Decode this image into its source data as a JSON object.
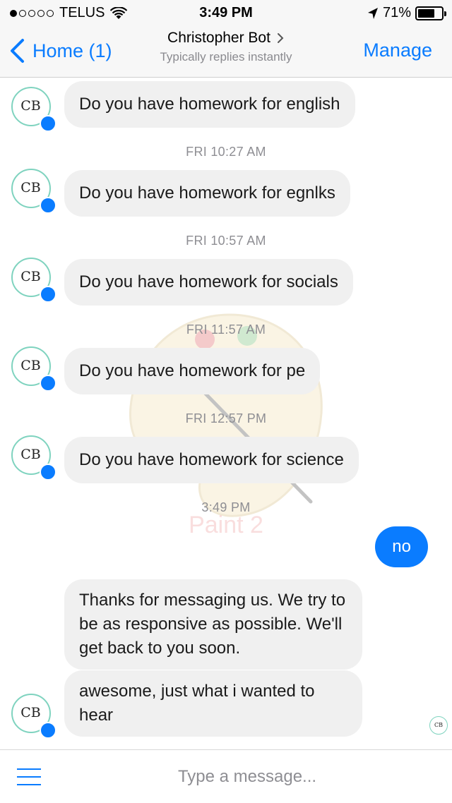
{
  "status_bar": {
    "carrier": "TELUS",
    "signal_dots_filled": 1,
    "signal_dots_total": 5,
    "time": "3:49 PM",
    "battery_text": "71%",
    "battery_level": 0.71
  },
  "nav": {
    "back_label": "Home (1)",
    "title": "Christopher Bot",
    "subtitle": "Typically replies instantly",
    "manage_label": "Manage"
  },
  "avatar": {
    "initials": "CB",
    "ring_color": "#7fd3bf",
    "badge_color": "#0a7cff"
  },
  "messages": [
    {
      "text": "Do you have homework for english"
    },
    {
      "timestamp": "FRI 10:27 AM",
      "text": "Do you have homework for egnlks"
    },
    {
      "timestamp": "FRI 10:57 AM",
      "text": "Do you have homework for socials"
    },
    {
      "timestamp": "FRI 11:57 AM",
      "text": "Do you have homework for pe"
    },
    {
      "timestamp": "FRI 12:57 PM",
      "text": "Do you have homework for science"
    }
  ],
  "final_timestamp": "3:49 PM",
  "outgoing": {
    "text": "no",
    "color": "#0a7cff"
  },
  "auto_reply": {
    "first": "Thanks for messaging us. We try to be as responsive as possible. We'll get back to you soon.",
    "second": "awesome, just what i wanted to hear"
  },
  "watermark": {
    "label": "Paint 2"
  },
  "composer": {
    "placeholder": "Type a message..."
  }
}
